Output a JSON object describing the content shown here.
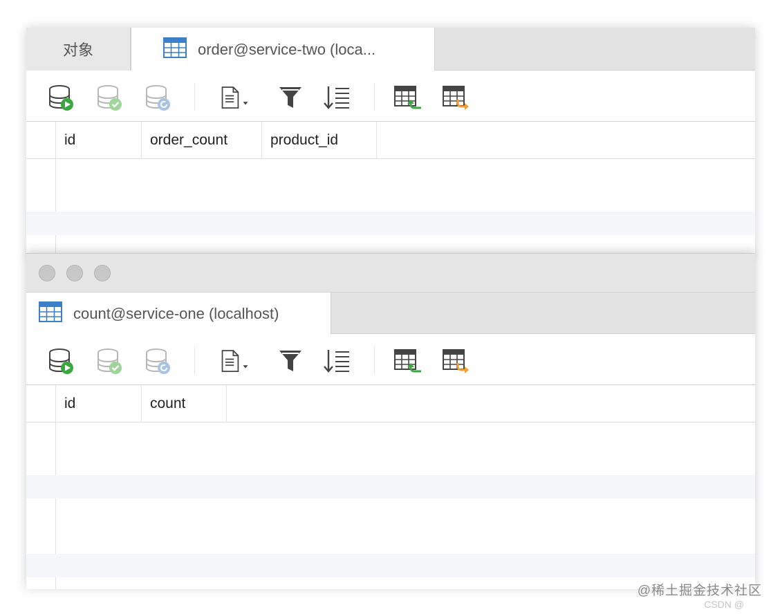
{
  "back_window": {
    "tabs": {
      "objects_label": "对象",
      "active_label": "order@service-two (loca..."
    },
    "columns": [
      "id",
      "order_count",
      "product_id"
    ]
  },
  "front_window": {
    "tab_label": "count@service-one (localhost)",
    "columns": [
      "id",
      "count"
    ]
  },
  "toolbar_icons": [
    "begin-transaction-icon",
    "commit-icon",
    "rollback-icon",
    "text-view-icon",
    "filter-icon",
    "sort-icon",
    "import-icon",
    "export-icon"
  ],
  "watermark": {
    "text": "@稀土掘金技术社区",
    "sub": "CSDN @"
  },
  "colors": {
    "tab_bar": "#e3e3e3",
    "accent_blue": "#3d7fc9",
    "green": "#3aa83f",
    "orange": "#f0a030"
  }
}
